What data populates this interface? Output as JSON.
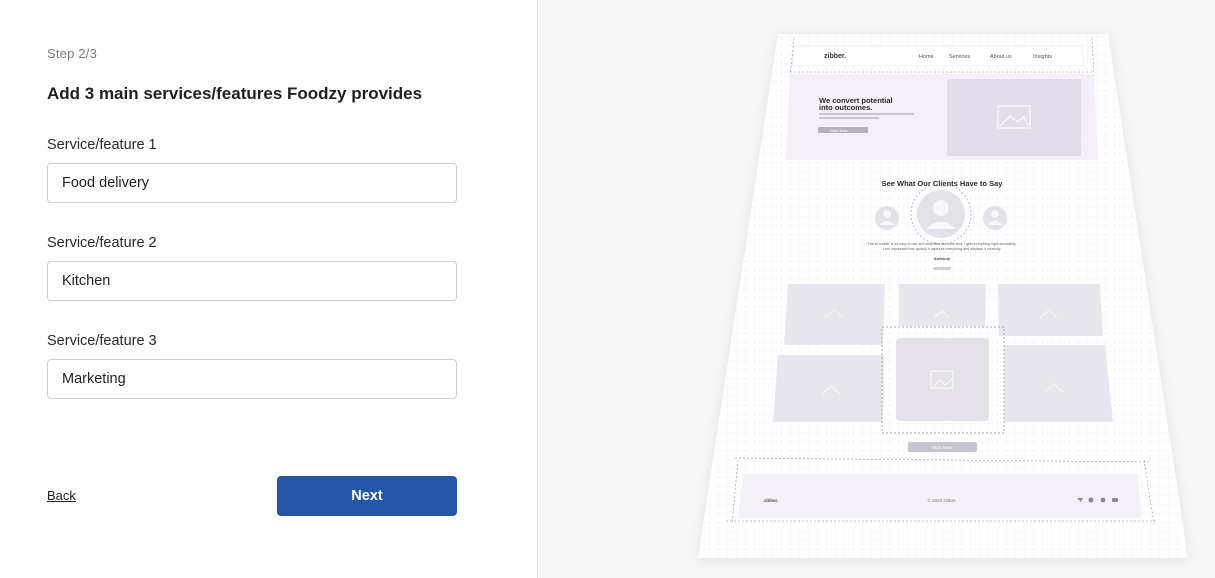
{
  "form": {
    "step": "Step 2/3",
    "title": "Add 3 main services/features Foodzy provides",
    "fields": [
      {
        "label": "Service/feature 1",
        "value": "Food delivery"
      },
      {
        "label": "Service/feature 2",
        "value": "Kitchen"
      },
      {
        "label": "Service/feature 3",
        "value": "Marketing"
      }
    ],
    "back_label": "Back",
    "next_label": "Next"
  },
  "preview": {
    "logo": "zibber.",
    "nav": [
      "Home",
      "Services",
      "About us",
      "Insights"
    ],
    "hero_title_line1": "We convert potential",
    "hero_title_line2": "into outcomes.",
    "hero_button": "Start Now",
    "testimonial_title": "See What Our Clients Have to Say",
    "testimonial_quote_line1": "The AI builder is so easy to use and simplifies the work flow, I gets everything right accurately.",
    "testimonial_quote_line2": "I am impressed how quickly it captures everything and displays it correctly.",
    "testimonial_author": "Anthony",
    "gallery_button": "Start Now",
    "footer_logo": "zibber.",
    "footer_copyright": "© 2022 zibber."
  },
  "colors": {
    "accent": "#2457a8",
    "hero_tint": "#f1ebf6",
    "placeholder": "#e8e6ec"
  }
}
